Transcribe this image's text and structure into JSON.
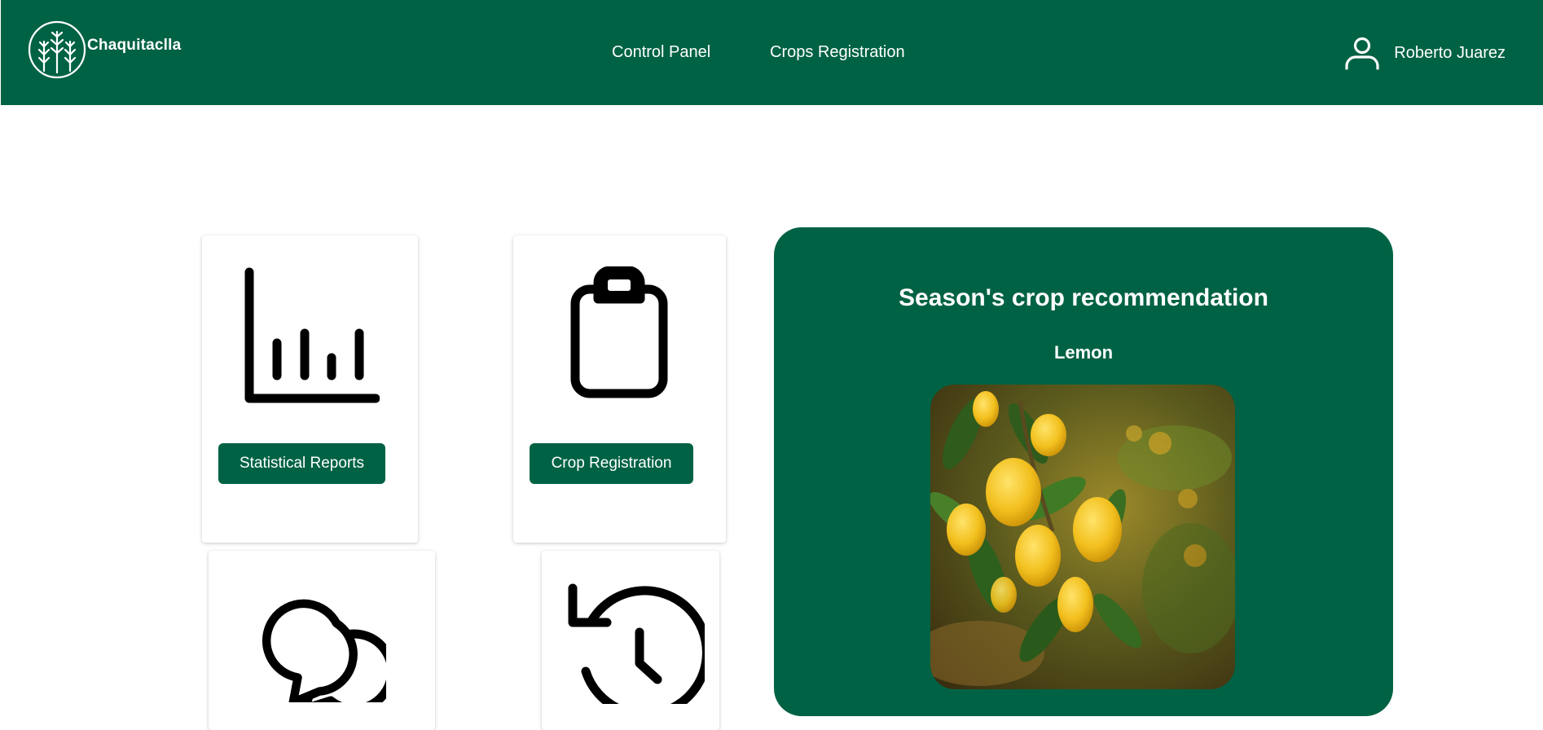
{
  "header": {
    "brand": "Chaquitaclla",
    "nav": [
      "Control Panel",
      "Crops Registration"
    ],
    "user_name": "Roberto Juarez"
  },
  "cards": [
    {
      "icon": "bar-chart-icon",
      "button": "Statistical Reports"
    },
    {
      "icon": "clipboard-icon",
      "button": "Crop Registration"
    },
    {
      "icon": "chat-bubbles-icon",
      "button": ""
    },
    {
      "icon": "history-icon",
      "button": ""
    }
  ],
  "recommendation": {
    "title": "Season's crop recommendation",
    "crop": "Lemon",
    "image_icon": "lemon-tree-photo"
  },
  "colors": {
    "primary": "#006244",
    "background": "#ffffff",
    "icon": "#000000",
    "lemon": "#f2c01e"
  }
}
